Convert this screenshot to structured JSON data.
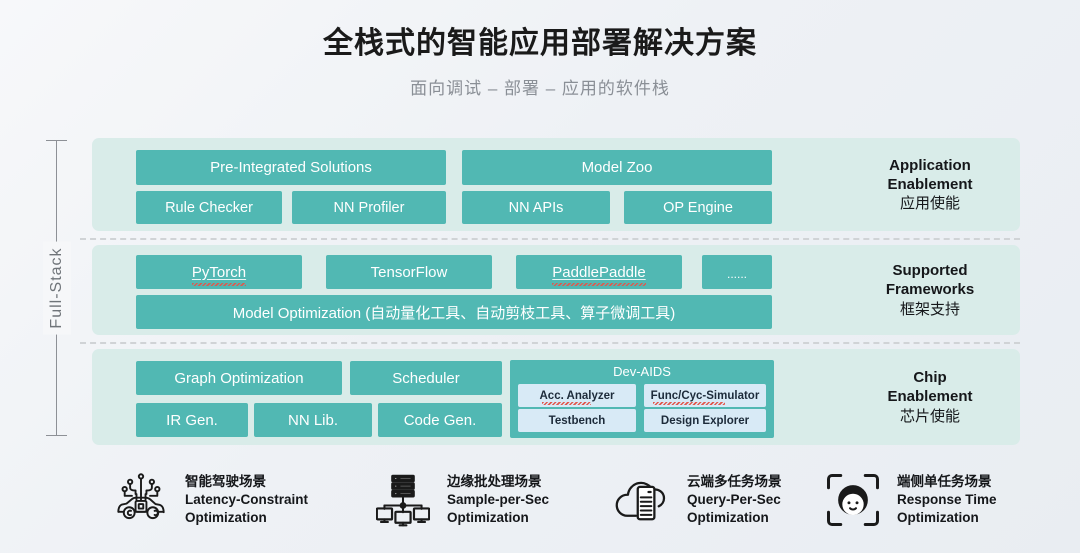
{
  "header": {
    "title": "全栈式的智能应用部署解决方案",
    "subtitle": "面向调试 – 部署 – 应用的软件栈"
  },
  "bracket": {
    "label": "Full-Stack"
  },
  "tiers": [
    {
      "id": "application",
      "label_en_line1": "Application",
      "label_en_line2": "Enablement",
      "label_cn": "应用使能",
      "boxes": [
        {
          "text": "Pre-Integrated Solutions"
        },
        {
          "text": "Model Zoo"
        },
        {
          "text": "Rule Checker"
        },
        {
          "text": "NN Profiler"
        },
        {
          "text": "NN APIs"
        },
        {
          "text": "OP Engine"
        }
      ]
    },
    {
      "id": "frameworks",
      "label_en_line1": "Supported",
      "label_en_line2": "Frameworks",
      "label_cn": "框架支持",
      "boxes": [
        {
          "text": "PyTorch"
        },
        {
          "text": "TensorFlow"
        },
        {
          "text": "PaddlePaddle"
        },
        {
          "text": "......"
        },
        {
          "text": "Model Optimization (自动量化工具、自动剪枝工具、算子微调工具)"
        }
      ]
    },
    {
      "id": "chip",
      "label_en_line1": "Chip",
      "label_en_line2": "Enablement",
      "label_cn": "芯片使能",
      "boxes": [
        {
          "text": "Graph Optimization"
        },
        {
          "text": "Scheduler"
        },
        {
          "text": "IR Gen."
        },
        {
          "text": "NN Lib."
        },
        {
          "text": "Code Gen."
        }
      ],
      "group": {
        "title": "Dev-AIDS",
        "items": [
          {
            "text": "Acc. Analyzer"
          },
          {
            "text": "Func/Cyc-Simulator"
          },
          {
            "text": "Testbench"
          },
          {
            "text": "Design Explorer"
          }
        ]
      }
    }
  ],
  "scenarios": [
    {
      "icon": "smart-car-chip-icon",
      "cn": "智能驾驶场景",
      "en_line1": "Latency-Constraint",
      "en_line2": "Optimization"
    },
    {
      "icon": "server-network-icon",
      "cn": "边缘批处理场景",
      "en_line1": "Sample-per-Sec",
      "en_line2": "Optimization"
    },
    {
      "icon": "cloud-server-icon",
      "cn": "云端多任务场景",
      "en_line1": "Query-Per-Sec",
      "en_line2": "Optimization"
    },
    {
      "icon": "face-scan-icon",
      "cn": "端侧单任务场景",
      "en_line1": "Response Time",
      "en_line2": "Optimization"
    }
  ],
  "colors": {
    "teal_box": "#51b8b3",
    "tier_panel": "#d9ece9",
    "subbox": "#d8eaf6",
    "text_dark": "#15171a",
    "subtitle": "#8a8f96"
  }
}
